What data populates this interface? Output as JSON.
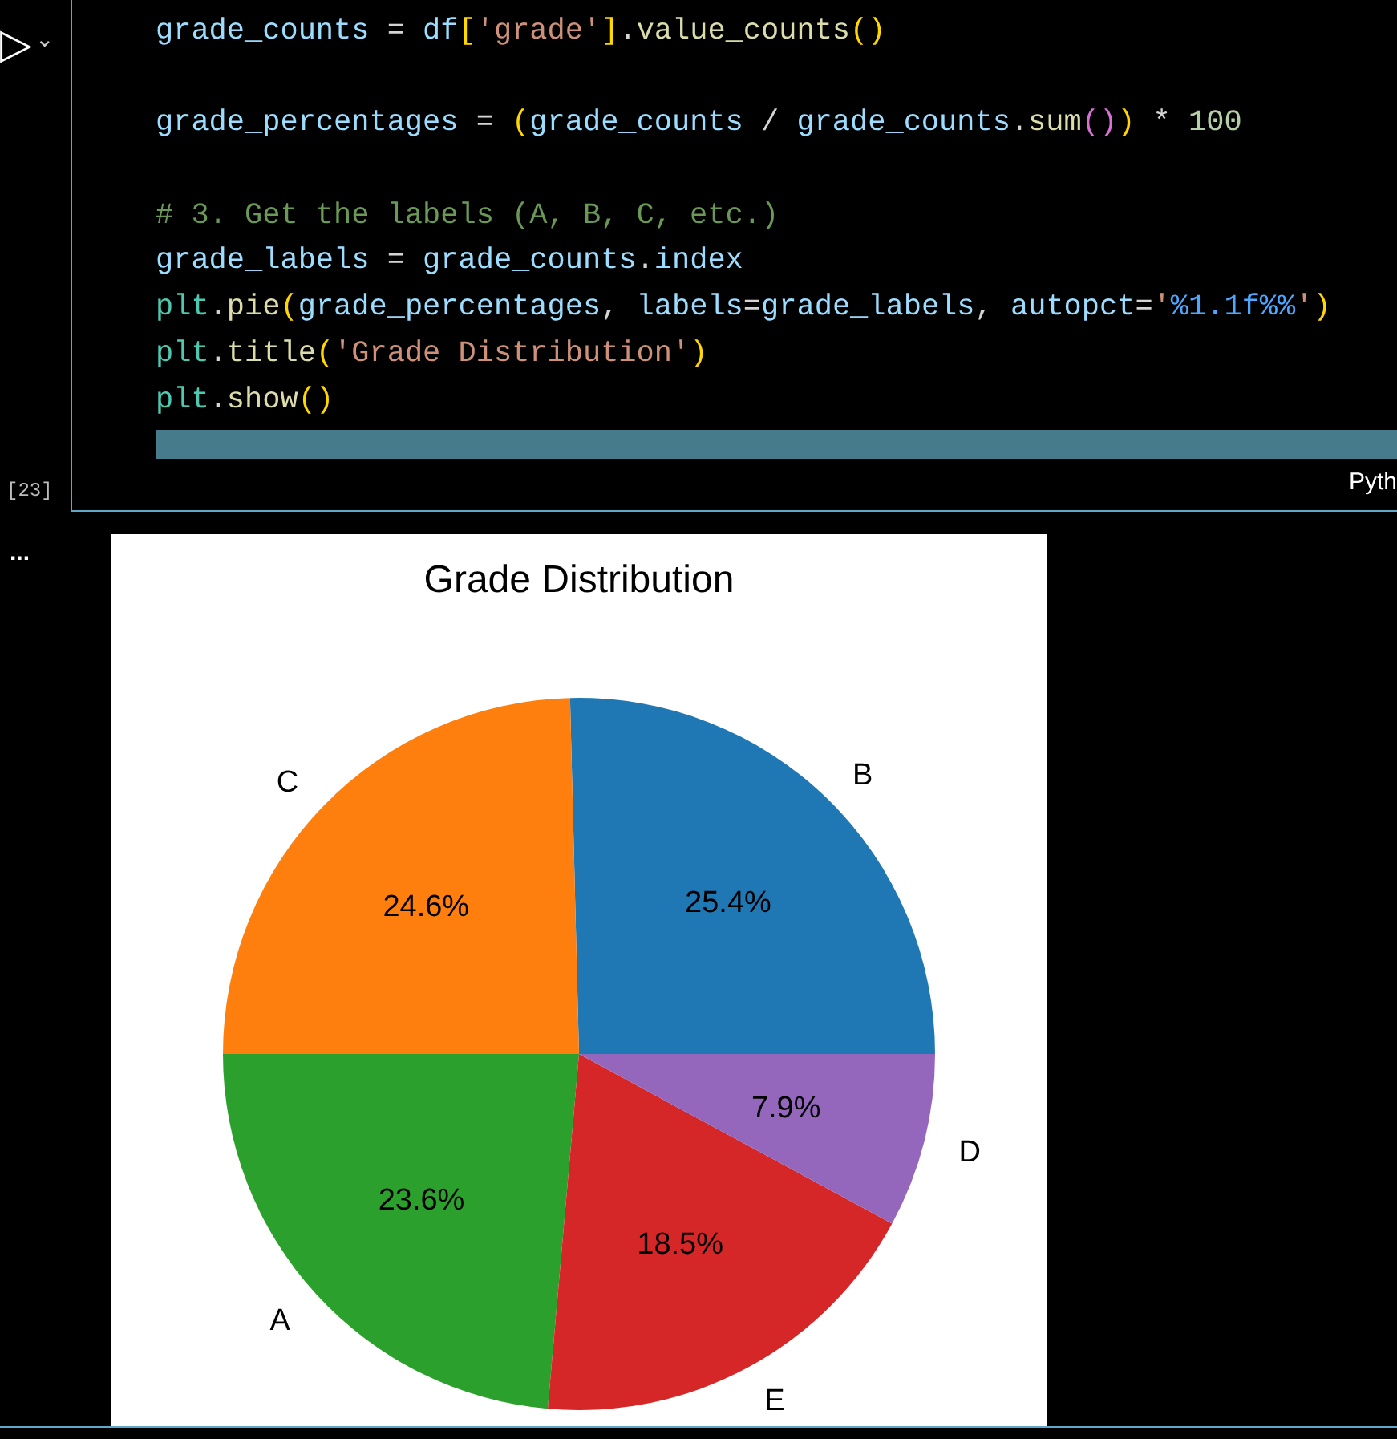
{
  "cell": {
    "run_button": "▷",
    "run_menu": "⌄",
    "execution_count": "[23]",
    "language": "Pyth",
    "code_lines": [
      {
        "tokens": [
          {
            "text": "grade_counts",
            "kind": "var"
          },
          {
            "text": " = ",
            "kind": "op"
          },
          {
            "text": "df",
            "kind": "var"
          },
          {
            "text": "[",
            "kind": "paren"
          },
          {
            "text": "'grade'",
            "kind": "str"
          },
          {
            "text": "]",
            "kind": "paren"
          },
          {
            "text": ".",
            "kind": "op"
          },
          {
            "text": "value_counts",
            "kind": "func"
          },
          {
            "text": "()",
            "kind": "paren"
          }
        ]
      },
      {
        "space_before": true,
        "tokens": [
          {
            "text": "grade_percentages",
            "kind": "var"
          },
          {
            "text": " = ",
            "kind": "op"
          },
          {
            "text": "(",
            "kind": "paren"
          },
          {
            "text": "grade_counts",
            "kind": "var"
          },
          {
            "text": " / ",
            "kind": "op"
          },
          {
            "text": "grade_counts",
            "kind": "var"
          },
          {
            "text": ".",
            "kind": "op"
          },
          {
            "text": "sum",
            "kind": "func"
          },
          {
            "text": "()",
            "kind": "paren2"
          },
          {
            "text": ")",
            "kind": "paren"
          },
          {
            "text": " * ",
            "kind": "op"
          },
          {
            "text": "100",
            "kind": "num"
          }
        ]
      },
      {
        "space_before": true,
        "tokens": [
          {
            "text": "# 3. Get the labels (A, B, C, etc.)",
            "kind": "comment"
          }
        ]
      },
      {
        "tokens": [
          {
            "text": "grade_labels",
            "kind": "var"
          },
          {
            "text": " = ",
            "kind": "op"
          },
          {
            "text": "grade_counts",
            "kind": "var"
          },
          {
            "text": ".",
            "kind": "op"
          },
          {
            "text": "index",
            "kind": "var"
          }
        ]
      },
      {
        "tokens": [
          {
            "text": "plt",
            "kind": "module"
          },
          {
            "text": ".",
            "kind": "op"
          },
          {
            "text": "pie",
            "kind": "func"
          },
          {
            "text": "(",
            "kind": "paren"
          },
          {
            "text": "grade_percentages",
            "kind": "var"
          },
          {
            "text": ", ",
            "kind": "op"
          },
          {
            "text": "labels",
            "kind": "var"
          },
          {
            "text": "=",
            "kind": "op"
          },
          {
            "text": "grade_labels",
            "kind": "var"
          },
          {
            "text": ", ",
            "kind": "op"
          },
          {
            "text": "autopct",
            "kind": "var"
          },
          {
            "text": "=",
            "kind": "op"
          },
          {
            "text": "'",
            "kind": "str"
          },
          {
            "text": "%1.1f%%",
            "kind": "format"
          },
          {
            "text": "'",
            "kind": "str"
          },
          {
            "text": ")",
            "kind": "paren"
          }
        ]
      },
      {
        "tokens": [
          {
            "text": "plt",
            "kind": "module"
          },
          {
            "text": ".",
            "kind": "op"
          },
          {
            "text": "title",
            "kind": "func"
          },
          {
            "text": "(",
            "kind": "paren"
          },
          {
            "text": "'Grade Distribution'",
            "kind": "str"
          },
          {
            "text": ")",
            "kind": "paren"
          }
        ]
      },
      {
        "tokens": [
          {
            "text": "plt",
            "kind": "module"
          },
          {
            "text": ".",
            "kind": "op"
          },
          {
            "text": "show",
            "kind": "func"
          },
          {
            "text": "()",
            "kind": "paren"
          }
        ]
      }
    ]
  },
  "output": {
    "more_button": "...",
    "chart_data": {
      "type": "pie",
      "title": "Grade Distribution",
      "categories": [
        "B",
        "C",
        "A",
        "E",
        "D"
      ],
      "values": [
        25.4,
        24.6,
        23.6,
        18.5,
        7.9
      ],
      "value_labels": [
        "25.4%",
        "24.6%",
        "23.6%",
        "18.5%",
        "7.9%"
      ]
    }
  }
}
